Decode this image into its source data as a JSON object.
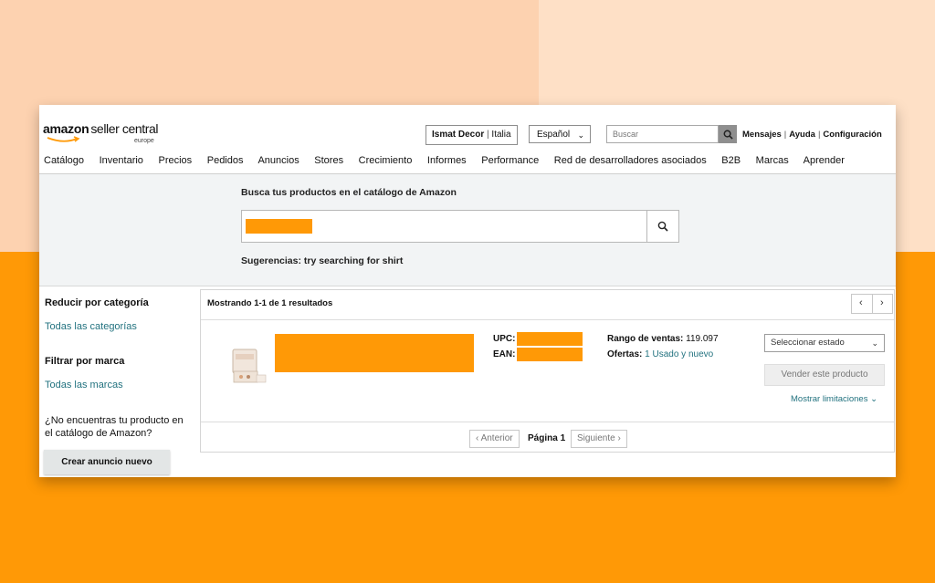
{
  "header": {
    "logo_brand": "amazon",
    "logo_product": "seller central",
    "logo_region": "europe",
    "store_name": "Ismat Decor",
    "store_country": "Italia",
    "language": "Español",
    "search_placeholder": "Buscar",
    "links": [
      "Mensajes",
      "Ayuda",
      "Configuración"
    ]
  },
  "nav": [
    "Catálogo",
    "Inventario",
    "Precios",
    "Pedidos",
    "Anuncios",
    "Stores",
    "Crecimiento",
    "Informes",
    "Performance",
    "Red de desarrolladores asociados",
    "B2B",
    "Marcas",
    "Aprender"
  ],
  "catalog_search": {
    "heading": "Busca tus productos en el catálogo de Amazon",
    "suggestion": "Sugerencias: try searching for shirt"
  },
  "sidebar": {
    "category_heading": "Reducir por categoría",
    "category_link": "Todas las categorías",
    "brand_heading": "Filtrar por marca",
    "brand_link": "Todas las marcas",
    "not_found_text": "¿No encuentras tu producto en el catálogo de Amazon?",
    "create_button": "Crear anuncio nuevo"
  },
  "results": {
    "summary": "Mostrando 1-1 de 1 resultados",
    "item": {
      "upc_label": "UPC:",
      "ean_label": "EAN:",
      "rank_label": "Rango de ventas:",
      "rank_value": "119.097",
      "offers_label": "Ofertas:",
      "offers_value": "1 Usado y nuevo",
      "state_select": "Seleccionar estado",
      "sell_button": "Vender este producto",
      "limits_link": "Mostrar limitaciones"
    },
    "pagination": {
      "prev": "Anterior",
      "page": "Página 1",
      "next": "Siguiente"
    }
  },
  "colors": {
    "accent_orange": "#ff9906",
    "link_teal": "#22727f",
    "panel_gray": "#f2f4f5"
  }
}
